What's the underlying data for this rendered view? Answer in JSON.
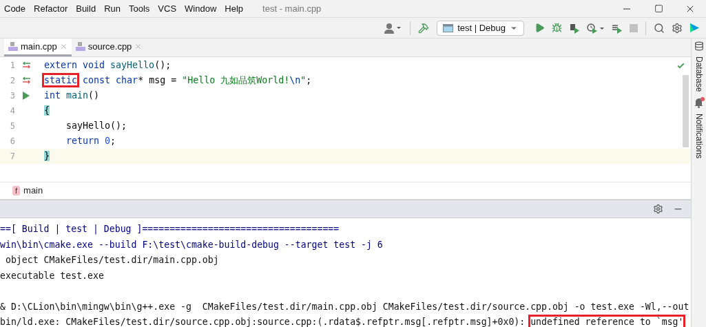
{
  "window": {
    "title": "test - main.cpp"
  },
  "menu": [
    "Code",
    "Refactor",
    "Build",
    "Run",
    "Tools",
    "VCS",
    "Window",
    "Help"
  ],
  "toolbar": {
    "run_config": "test | Debug"
  },
  "tabs": [
    {
      "label": "main.cpp",
      "selected": true
    },
    {
      "label": "source.cpp",
      "selected": false
    }
  ],
  "editor": {
    "lines": [
      {
        "number": "1",
        "gutter": {
          "kind": "swap"
        },
        "current": false,
        "tokens": [
          {
            "text": "extern ",
            "kind": "keyword",
            "boxed": false
          },
          {
            "text": "void ",
            "kind": "keyword",
            "boxed": false
          },
          {
            "text": "sayHello",
            "kind": "decl",
            "boxed": false
          },
          {
            "text": "();",
            "kind": "plain",
            "boxed": false
          }
        ]
      },
      {
        "number": "2",
        "gutter": {
          "kind": "swap"
        },
        "current": false,
        "tokens": [
          {
            "text": "static",
            "kind": "keyword",
            "boxed": true
          },
          {
            "text": " const ",
            "kind": "keyword",
            "boxed": false
          },
          {
            "text": "char",
            "kind": "keyword",
            "boxed": false
          },
          {
            "text": "* msg = ",
            "kind": "plain",
            "boxed": false
          },
          {
            "text": "\"Hello 九如品筑World!",
            "kind": "string",
            "boxed": false
          },
          {
            "text": "\\n",
            "kind": "escape",
            "boxed": false
          },
          {
            "text": "\"",
            "kind": "string",
            "boxed": false
          },
          {
            "text": ";",
            "kind": "plain",
            "boxed": false
          }
        ]
      },
      {
        "number": "3",
        "gutter": {
          "kind": "run"
        },
        "current": false,
        "tokens": [
          {
            "text": "int ",
            "kind": "keyword",
            "boxed": false
          },
          {
            "text": "main",
            "kind": "decl",
            "boxed": false
          },
          {
            "text": "()",
            "kind": "plain",
            "boxed": false
          }
        ]
      },
      {
        "number": "4",
        "current": false,
        "tokens": [
          {
            "text": "{",
            "kind": "brace",
            "boxed": false
          }
        ]
      },
      {
        "number": "5",
        "current": false,
        "tokens": [
          {
            "text": "    sayHello();",
            "kind": "plain",
            "boxed": false
          }
        ]
      },
      {
        "number": "6",
        "current": false,
        "tokens": [
          {
            "text": "    return ",
            "kind": "keyword",
            "boxed": false
          },
          {
            "text": "0",
            "kind": "number",
            "boxed": false
          },
          {
            "text": ";",
            "kind": "plain",
            "boxed": false
          }
        ]
      },
      {
        "number": "7",
        "current": true,
        "tokens": [
          {
            "text": "}",
            "kind": "brace",
            "boxed": false
          }
        ]
      }
    ]
  },
  "breadcrumb": {
    "badge": "f",
    "label": "main"
  },
  "right_sidebar": [
    "Database",
    "Notifications"
  ],
  "console": {
    "lines": [
      {
        "after_blank": false,
        "segments": [
          {
            "text": "==[ Build | test | Debug ]====================================",
            "kind": "command",
            "boxed": false
          }
        ]
      },
      {
        "after_blank": false,
        "segments": [
          {
            "text": "win\\bin\\cmake.exe --build F:\\test\\cmake-build-debug --target test -j 6",
            "kind": "command",
            "boxed": false
          }
        ]
      },
      {
        "after_blank": false,
        "segments": [
          {
            "text": " object CMakeFiles/test.dir/main.cpp.obj",
            "kind": "output",
            "boxed": false
          }
        ]
      },
      {
        "after_blank": false,
        "segments": [
          {
            "text": "executable test.exe",
            "kind": "output",
            "boxed": false
          }
        ]
      },
      {
        "after_blank": true,
        "segments": [
          {
            "text": "& D:\\CLion\\bin\\mingw\\bin\\g++.exe -g  CMakeFiles/test.dir/main.cpp.obj CMakeFiles/test.dir/source.cpp.obj -o test.exe -Wl,--out",
            "kind": "output",
            "boxed": false
          }
        ]
      },
      {
        "after_blank": false,
        "segments": [
          {
            "text": "bin/ld.exe: CMakeFiles/test.dir/source.cpp.obj:source.cpp:(.rdata$.refptr.msg[.refptr.msg]+0x0): ",
            "kind": "output",
            "boxed": false
          },
          {
            "text": "undefined reference to `msg'",
            "kind": "output",
            "boxed": true
          }
        ]
      }
    ]
  }
}
